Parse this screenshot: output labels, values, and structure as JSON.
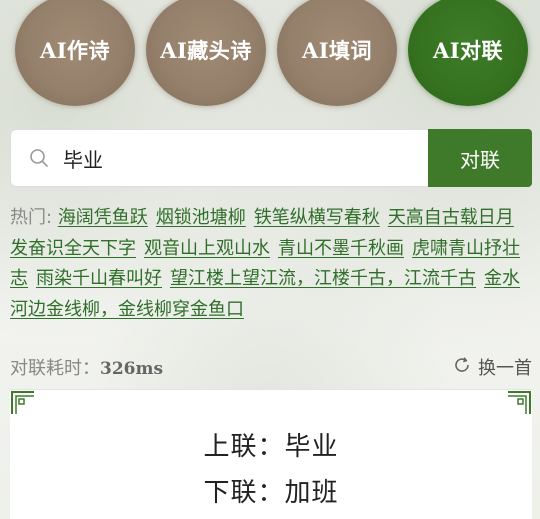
{
  "tabs": [
    {
      "label": "AI作诗",
      "active": false
    },
    {
      "label": "AI藏头诗",
      "active": false
    },
    {
      "label": "AI填词",
      "active": false
    },
    {
      "label": "AI对联",
      "active": true
    }
  ],
  "search": {
    "value": "毕业",
    "button_label": "对联"
  },
  "hot": {
    "label": "热门:",
    "items": [
      "海阔凭鱼跃",
      "烟锁池塘柳",
      "铁笔纵横写春秋",
      "天高自古载日月",
      "发奋识全天下字",
      "观音山上观山水",
      "青山不墨千秋画",
      "虎啸青山抒壮志",
      "雨染千山春叫好",
      "望江楼上望江流，江楼千古，江流千古",
      "金水河边金线柳，金线柳穿金鱼口"
    ]
  },
  "meta": {
    "time_label": "对联耗时：",
    "time_value": "326ms",
    "refresh_label": "换一首"
  },
  "result": {
    "upper": "上联：毕业",
    "lower": "下联：加班"
  },
  "colors": {
    "active_tab": "#35711f",
    "inactive_tab": "#94806b",
    "accent": "#3e7a2a",
    "link": "#2f6f2a"
  }
}
